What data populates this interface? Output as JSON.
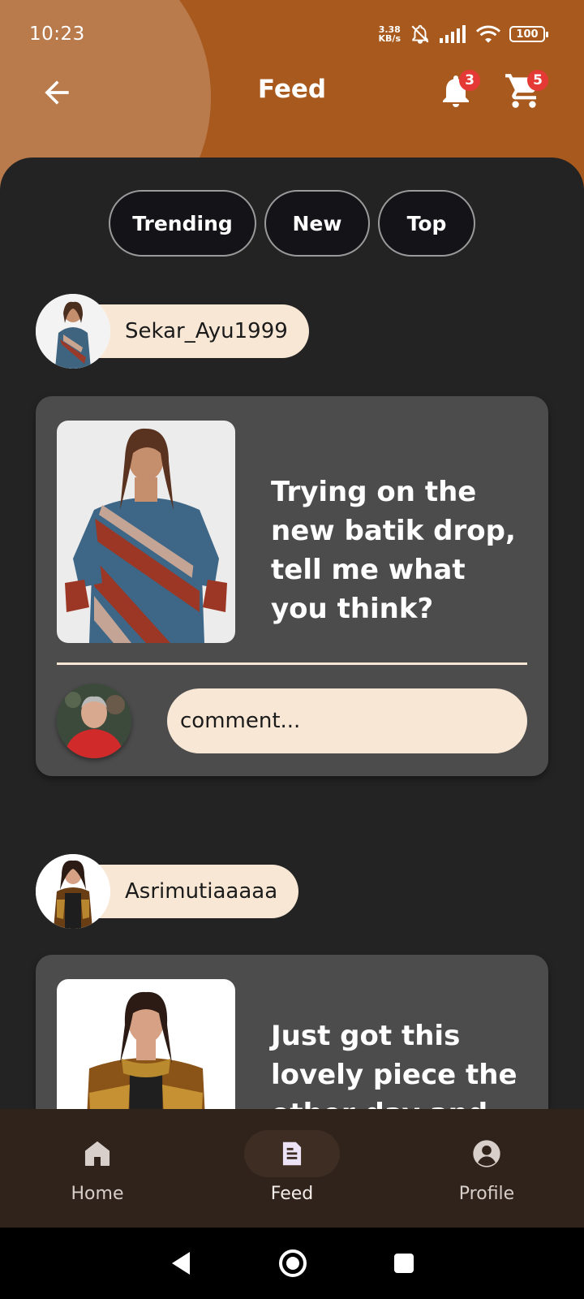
{
  "status_bar": {
    "time": "10:23",
    "net_speed_value": "3.38",
    "net_speed_unit": "KB/s",
    "battery": "100"
  },
  "app_bar": {
    "title": "Feed",
    "notification_count": "3",
    "cart_count": "5"
  },
  "filter_tabs": [
    {
      "label": "Trending"
    },
    {
      "label": "New"
    },
    {
      "label": "Top"
    }
  ],
  "posts": [
    {
      "username": "Sekar_Ayu1999",
      "text": "Trying on the new batik drop, tell me what you think?",
      "comment_placeholder": "comment..."
    },
    {
      "username": "Asrimutiaaaaa",
      "text": "Just got this lovely piece the other day and had"
    }
  ],
  "bottom_nav": {
    "items": [
      {
        "label": "Home",
        "icon": "home-icon",
        "active": false
      },
      {
        "label": "Feed",
        "icon": "article-icon",
        "active": true
      },
      {
        "label": "Profile",
        "icon": "account-circle-icon",
        "active": false
      }
    ]
  },
  "colors": {
    "header_brown": "#a8591d",
    "header_blob": "#b97a4c",
    "background": "#232323",
    "card": "#4c4c4c",
    "cream": "#f8e7d4",
    "badge_red": "#e53935",
    "nav_bar": "#2f231b"
  }
}
